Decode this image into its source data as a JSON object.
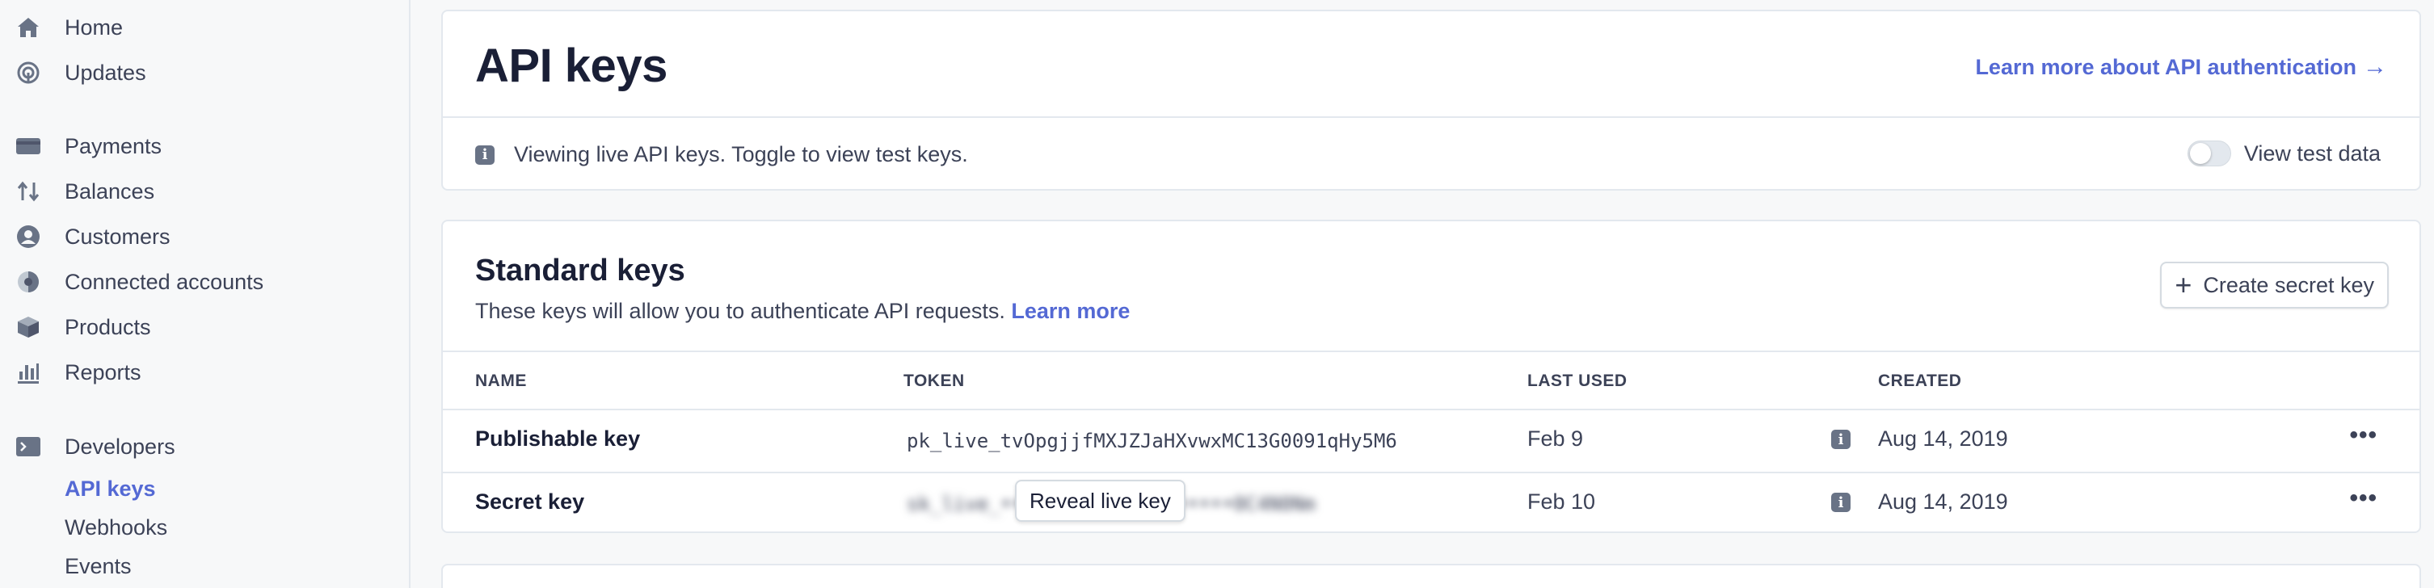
{
  "sidebar": {
    "items": [
      {
        "label": "Home",
        "icon": "home-icon"
      },
      {
        "label": "Updates",
        "icon": "updates-icon"
      },
      {
        "label": "Payments",
        "icon": "payments-icon"
      },
      {
        "label": "Balances",
        "icon": "balances-icon"
      },
      {
        "label": "Customers",
        "icon": "customers-icon"
      },
      {
        "label": "Connected accounts",
        "icon": "connected-accounts-icon"
      },
      {
        "label": "Products",
        "icon": "products-icon"
      },
      {
        "label": "Reports",
        "icon": "reports-icon"
      },
      {
        "label": "Developers",
        "icon": "developers-icon"
      }
    ],
    "developers_sub": [
      "API keys",
      "Webhooks",
      "Events"
    ]
  },
  "header": {
    "title": "API keys",
    "learn_link": "Learn more about API authentication",
    "notice": "Viewing live API keys. Toggle to view test keys.",
    "toggle_label": "View test data"
  },
  "standard_keys": {
    "title": "Standard keys",
    "description": "These keys will allow you to authenticate API requests.",
    "learn_more": "Learn more",
    "create_button": "Create secret key",
    "columns": [
      "NAME",
      "TOKEN",
      "LAST USED",
      "CREATED"
    ],
    "rows": [
      {
        "name": "Publishable key",
        "token": "pk_live_tvOpgjjfMXJZJaHXvwxMC13G0091qHy5M6",
        "last_used": "Feb 9",
        "created": "Aug 14, 2019"
      },
      {
        "name": "Secret key",
        "token": "sk_live_••••••••••••••••••••0C4N0Nm",
        "last_used": "Feb 10",
        "created": "Aug 14, 2019",
        "reveal": "Reveal live key"
      }
    ]
  },
  "colors": {
    "accent": "#5469d4",
    "text": "#1a1f36",
    "muted": "#3c4257"
  }
}
